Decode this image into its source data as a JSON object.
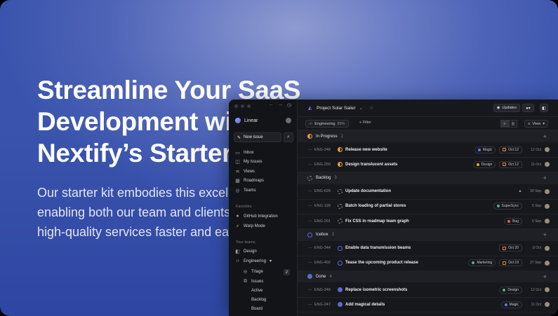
{
  "hero": {
    "title": "Streamline Your SaaS Development with Nextify’s Starter Kit",
    "subtitle": "Our starter kit embodies this excellence, enabling both our team and clients to build high-quality services faster and easier."
  },
  "sidebar": {
    "workspace": "Linear",
    "new_issue": "New issue",
    "nav": [
      "Inbox",
      "My issues",
      "Views",
      "Roadmaps",
      "Teams"
    ],
    "favorites_label": "Favorites",
    "favorites": [
      "GitHub Integration",
      "Warp Mode"
    ],
    "teams_label": "Your teams",
    "teams": [
      "Design",
      "Engineering"
    ],
    "triage": "Triage",
    "triage_count": "2",
    "issues": "Issues",
    "issue_views": [
      "Active",
      "Backlog",
      "Board"
    ]
  },
  "topbar": {
    "project": "Project Solar Sailer",
    "updates": "Updates"
  },
  "filterbar": {
    "team": "Engineering",
    "team_pct": "89%",
    "filter": "Filter",
    "view": "View"
  },
  "groups": [
    {
      "name": "In Progress",
      "count": "2",
      "color": "#e8a23a",
      "rows": [
        {
          "id": "ENG-248",
          "title": "Release new website",
          "tag": "Magic",
          "tag_color": "#5b7cf0",
          "date": "Oct 12",
          "created": "12 Oct"
        },
        {
          "id": "ENG-250",
          "title": "Design translucent assets",
          "tag": "Design",
          "tag_color": "#e8a23a",
          "date": "Oct 12",
          "created": "11 Oct"
        }
      ]
    },
    {
      "name": "Backlog",
      "count": "3",
      "color": "#8a8b92",
      "rows": [
        {
          "id": "ENG-628",
          "title": "Update documentation",
          "tag": "",
          "date": "",
          "created": "30 Sep"
        },
        {
          "id": "ENG-199",
          "title": "Batch loading of partial stores",
          "tag": "SuperSync",
          "tag_color": "#4cb782",
          "date": "",
          "created": "5 Sep"
        },
        {
          "id": "ENG-201",
          "title": "Fix CSS in roadmap team graph",
          "tag": "Bug",
          "tag_color": "#eb5757",
          "date": "",
          "created": "5 Sep"
        }
      ]
    },
    {
      "name": "Icebox",
      "count": "2",
      "color": "#5e6ad2",
      "rows": [
        {
          "id": "ENG-344",
          "title": "Enable data transmission beams",
          "tag": "",
          "date": "Oct 20",
          "created": "8 Oct"
        },
        {
          "id": "ENG-402",
          "title": "Tease the upcoming product release",
          "tag": "Marketing",
          "tag_color": "#4cb782",
          "date": "Oct 19",
          "created": "27 Sep"
        }
      ]
    },
    {
      "name": "Done",
      "count": "4",
      "color": "#5e6ad2",
      "rows": [
        {
          "id": "ENG-249",
          "title": "Replace isometric screenshots",
          "tag": "Design",
          "tag_color": "#4cb782",
          "date": "",
          "created": "12 Oct"
        },
        {
          "id": "ENG-247",
          "title": "Add magical details",
          "tag": "Magic",
          "tag_color": "#5b7cf0",
          "date": "",
          "created": "11 Oct"
        }
      ]
    }
  ]
}
